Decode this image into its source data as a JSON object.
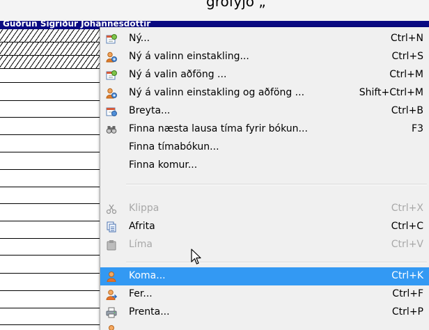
{
  "window": {
    "top_caption": "grófýjó „",
    "person_name": "Guðrún Sigríður Jóhannesdóttir"
  },
  "menu": {
    "items": [
      {
        "label": "Ný...",
        "shortcut": "Ctrl+N",
        "icon": "calendar-new-icon",
        "enabled": true
      },
      {
        "label": "Ný á valinn einstakling...",
        "shortcut": "Ctrl+S",
        "icon": "person-new-icon",
        "enabled": true
      },
      {
        "label": "Ný á valin aðföng ...",
        "shortcut": "Ctrl+M",
        "icon": "calendar-new-icon",
        "enabled": true
      },
      {
        "label": "Ný á valinn einstakling og aðföng ...",
        "shortcut": "Shift+Ctrl+M",
        "icon": "person-new-icon",
        "enabled": true
      },
      {
        "label": "Breyta...",
        "shortcut": "Ctrl+B",
        "icon": "calendar-edit-icon",
        "enabled": true
      },
      {
        "label": "Finna næsta lausa tíma fyrir bókun...",
        "shortcut": "F3",
        "icon": "binoculars-icon",
        "enabled": true
      },
      {
        "label": "Finna tímabókun...",
        "shortcut": "",
        "icon": "",
        "enabled": true
      },
      {
        "label": "Finna komur...",
        "shortcut": "",
        "icon": "",
        "enabled": true
      },
      {
        "label": "Klippa",
        "shortcut": "Ctrl+X",
        "icon": "scissors-icon",
        "enabled": false
      },
      {
        "label": "Afrita",
        "shortcut": "Ctrl+C",
        "icon": "copy-icon",
        "enabled": true
      },
      {
        "label": "Líma",
        "shortcut": "Ctrl+V",
        "icon": "paste-icon",
        "enabled": false
      },
      {
        "label": "Koma...",
        "shortcut": "Ctrl+K",
        "icon": "person-arrive-icon",
        "enabled": true,
        "highlighted": true
      },
      {
        "label": "Fer...",
        "shortcut": "Ctrl+F",
        "icon": "person-leave-icon",
        "enabled": true
      },
      {
        "label": "Prenta...",
        "shortcut": "Ctrl+P",
        "icon": "printer-icon",
        "enabled": true
      }
    ]
  },
  "colors": {
    "highlight": "#3399f3",
    "name_bar": "#0a0a82",
    "menu_bg": "#f0f0f0",
    "disabled_text": "#a8a8a8"
  }
}
